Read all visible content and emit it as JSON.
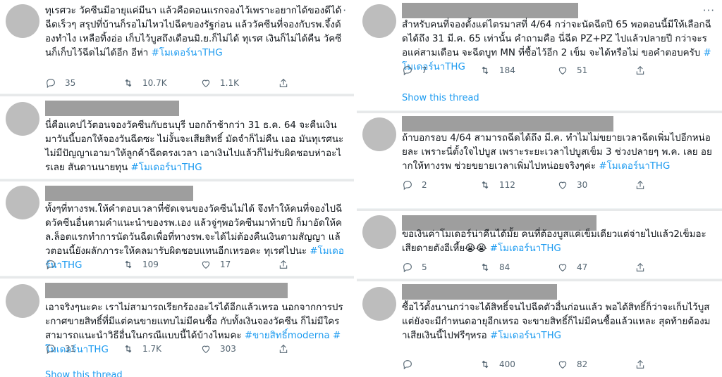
{
  "left_tweets": [
    {
      "text": "ทุเรศวะ วัคซีนมีอายุแค่มีนา แล้วคือตอนแรกจองไว้เพราะอยากได้ของดีได้ฉีดเร็วๆ สรุปที่บ้านก็รอไม่ไหวไปฉีดของรัฐก่อน แล้ววัคซีนที่จองกับรพ.จึ้งต้องทำไง เหลือทิ้งอ่อ เก็บไว้บูสถึงเดือนมิ.ย.ก็ไม่ได้ ทุเรศ เงินก็ไม่ได้คืน วัคซีนก็เก็บไว้ฉีดไม่ได้อีก อีห่า ",
      "hashtag": "#โมเดอร์นาTHG",
      "replies": "35",
      "retweets": "10.7K",
      "likes": "1.1K"
    },
    {
      "text": "นี่คือแคปไว้ตอนจองวัคซีนกับธนบุรี บอกถ้าช้ากว่า 31 ธ.ค. 64 จะคืนเงิน มาวันนี้บอกให้จองวันฉีดซะ ไม่งั้นจะเสียสิทธิ์ มัดจำก็ไม่คืน เออ มันทุเรศนะ ไม่มีปัญญาเอามาให้ลูกค้าฉีดตรงเวลา เอาเงินไปแล้วก็ไม่รับผิดชอบห่าอะไรเลย สันดานนายทุน ",
      "hashtag": "#โมเดอร์นาTHG"
    },
    {
      "text": "ทั้งๆที่ทางรพ.ให้คำตอบเวลาที่ชัดเจนของวัคซีนไม่ได้ จึงทำให้คนที่จองไปฉีดวัคซีนอื่นตามคำแนะนำของรพ.เอง แล้วจู่ๆพอวัคซีนมาท้ายปี ก็มาอัดให้คล.ล็อตแรกทำการนัดวันฉีดเพื่อที่ทางรพ.จะได้ไม่ต้องคืนเงินตามสัญญา แล้วตอนนี้ยังผลักภาระให้คลมารับผิดชอบแทนอีกเหรอคะ ทุเรศไปนะ ",
      "hashtag": "#โมเดอร์นาTHG",
      "replies": "",
      "retweets": "109",
      "likes": "17"
    },
    {
      "text": "เอาจริงๆนะคะ เราไม่สามารถเรียกร้องอะไรได้อีกแล้วเหรอ นอกจากการประกาศขายสิทธิ์ที่มีแต่คนขายแทบไม่มีคนซื้อ กับทั้งเงินจองวัคซีน ก็ไม่มีใครสามารถแนะนำวิธีอื่นในกรณีแบบนี้ได้บ้างไหมคะ ",
      "hashtag": "#ขายสิทธิ์moderna",
      "hashtag2": "#โมเดอร์นาTHG",
      "replies": "31",
      "retweets": "1.7K",
      "likes": "303"
    }
  ],
  "left_show_thread": "Show this thread",
  "right_tweets": [
    {
      "text": "สำหรับคนที่จองตั้งแต่ไตรมาสที่ 4/64 กว่าจะนัดฉีดปี 65 พอตอนนี้มีให้เลือกฉีดได้ถึง 31 มี.ค. 65 เท่านั้น คำถามคือ นี่ฉีด PZ+PZ ไปแล้วปลายปี กว่าจะรอแค่สามเดือน จะฉีดบูท MN ที่ซื้อไว้อีก 2 เข็ม จะได้หรือไม่ ขอคำตอบครับ ",
      "hashtag": "#โมเดอร์นาTHG",
      "replies": "7",
      "retweets": "184",
      "likes": "51"
    },
    {
      "text": "ถ้าบอกรอบ 4/64 สามารถฉีดได้ถึง มี.ค. ทำไมไม่ขยายเวลาฉีดเพิ่มไปอีกหน่อยละ เพราะนี่ตั้งใจไปบูส เพราะระยะเวลาไปบูสเข็ม 3 ช่วงปลายๆ พ.ค. เลย อยากให้ทางรพ ช่วยขยายเวลาเพิ่มไปหน่อยจริงๆค่ะ ",
      "hashtag": "#โมเดอร์นาTHG",
      "replies": "2",
      "retweets": "112",
      "likes": "30"
    },
    {
      "text": "ขอเงินค่าโมเดอร์น่าคืนได้มั้ย คนที่ต้องบูสแค่เข็มเดียวแต่จ่ายไปแล้ว2เข็มอะ เสียดายตังอีเหี้ย😭😭 ",
      "hashtag": "#โมเดอร์นาTHG",
      "replies": "5",
      "retweets": "84",
      "likes": "47"
    },
    {
      "text": "ซื้อไว้ตั้งนานกว่าจะได้สิทธิ์จนไปฉีดตัวอื่นก่อนแล้ว พอได้สิทธิ์ก็ว่าจะเก็บไว้บูส แต่ยังจะมีกำหนดอายุอีกเหรอ จะขายสิทธิ์ก็ไม่มีคนซื้อแล้วแหละ สุดท้ายต้องมาเสียเงินนี้ไปฟรีๆหรอ ",
      "hashtag": "#โมเดอร์นาTHG",
      "replies": "",
      "retweets": "400",
      "likes": "82"
    }
  ],
  "right_show_thread": "Show this thread"
}
